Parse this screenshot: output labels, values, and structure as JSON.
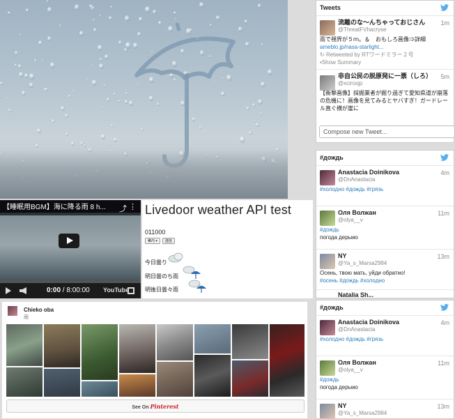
{
  "video": {
    "title": "【睡眠用BGM】海に降る雨 8 h...",
    "current_time": "0:00",
    "duration": "8:00:00",
    "brand": "YouTube"
  },
  "weather": {
    "title": "Livedoor weather API test",
    "code": "011000",
    "select_value": "稚内",
    "submit_label": "送信",
    "today": "今日曇り",
    "tomorrow": "明日曇のち雨",
    "day_after": "明後日曇々雨"
  },
  "pinterest": {
    "user_name": "Chieko oba",
    "board_name": "雨",
    "see_on_label": "See On",
    "brand": "Pinterest"
  },
  "tweets_widget": {
    "title": "Tweets",
    "compose_placeholder": "Compose new Tweet...",
    "tweets": [
      {
        "name": "流離のな～んちゃっておじさん",
        "handle": "@ThreatFVhacryse",
        "time": "1m",
        "text": "雨で視界が５ｍ。＆　おもしろ画像⇒詳細",
        "link": "ameblo.jp/nasa-starlight...",
        "retweet": "Retweeted by RTワードミラー２号",
        "summary": "Show Summary"
      },
      {
        "name": "非自公民の脱原発に一票（しろ）",
        "handle": "@xciroxjp",
        "time": "5m",
        "text": "【衝撃画像】採掘業者が掘り過ぎて愛知県道が崩落の危機に！画像を見てみるとヤバすぎ！ガードレール直ぐ横が崖に"
      }
    ]
  },
  "rain_widget_1": {
    "title": "#дождь",
    "tweets": [
      {
        "name": "Anastacia Doinikova",
        "handle": "@DnAnastacia",
        "time": "4m",
        "text": "#холодно #дождь #грязь"
      },
      {
        "name": "Оля Волжан",
        "handle": "@olya__v",
        "time": "11m",
        "text_tag": "#дождь",
        "text": "погода дерьмо"
      },
      {
        "name": "NY",
        "handle": "@Ya_s_Marsa2984",
        "time": "13m",
        "text": "Осень, твою мать, уйди обратно!",
        "tags": "#осень #дождь #холодно"
      }
    ],
    "partial_name": "Natalia Sh..."
  },
  "rain_widget_2": {
    "title": "#дождь",
    "tweets": [
      {
        "name": "Anastacia Doinikova",
        "handle": "@DnAnastacia",
        "time": "4m",
        "text": "#холодно #дождь #грязь"
      },
      {
        "name": "Оля Волжан",
        "handle": "@olya__v",
        "time": "11m",
        "text_tag": "#дождь",
        "text": "погода дерьмо"
      },
      {
        "name": "NY",
        "handle": "@Ya_s_Marsa2984",
        "time": "13m"
      }
    ]
  },
  "colors": {
    "twitter_blue": "#55acee",
    "link_blue": "#2b7bb9",
    "pinterest_red": "#cb2027"
  }
}
